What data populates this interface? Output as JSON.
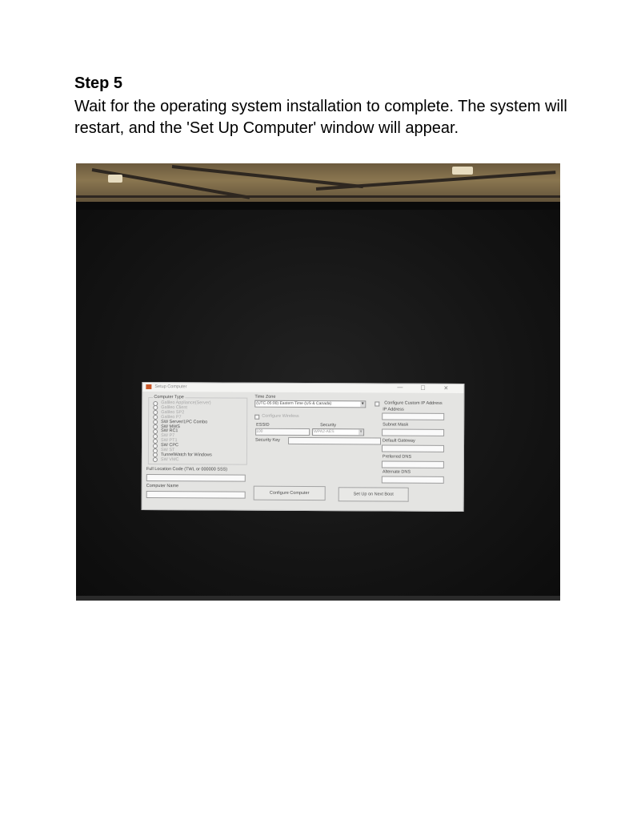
{
  "step": {
    "title": "Step 5",
    "text": "Wait for the operating system installation to complete. The system will restart, and the 'Set Up Computer' window will appear."
  },
  "dialog": {
    "title": "Setup Computer",
    "controls": {
      "minimize": "—",
      "maximize": "☐",
      "close": "✕"
    },
    "computer_type": {
      "legend": "Computer Type",
      "options": [
        {
          "label": "Galileo Appliance(Server)",
          "enabled": false
        },
        {
          "label": "Galileo Client",
          "enabled": false
        },
        {
          "label": "Galileo SP2",
          "enabled": false
        },
        {
          "label": "Galileo P7",
          "enabled": false
        },
        {
          "label": "SW Server/1PC Combo",
          "enabled": true
        },
        {
          "label": "SW MWS",
          "enabled": true
        },
        {
          "label": "SW RC1",
          "enabled": true
        },
        {
          "label": "SW P7",
          "enabled": false
        },
        {
          "label": "SW PT1",
          "enabled": false
        },
        {
          "label": "SW CPC",
          "enabled": true
        },
        {
          "label": "SW ST",
          "enabled": false
        },
        {
          "label": "TunnelWatch for Windows",
          "enabled": true
        },
        {
          "label": "SW VMC",
          "enabled": false
        }
      ]
    },
    "full_location_code_label": "Full Location Code (TWL or 000000 SSS)",
    "computer_name_label": "Computer Name",
    "time_zone": {
      "label": "Time Zone",
      "value": "(UTC-05:00) Eastern Time (US & Canada)"
    },
    "wireless": {
      "configure_label": "Configure Wireless",
      "essid_label": "ESSID",
      "essid_value": "100",
      "security_label": "Security",
      "security_value": "WPA2-AES",
      "security_key_label": "Security Key"
    },
    "ip": {
      "configure_label": "Configure Custom IP Address",
      "ip_address_label": "IP Address",
      "subnet_mask_label": "Subnet Mask",
      "default_gateway_label": "Default Gateway",
      "preferred_dns_label": "Preferred DNS",
      "alternate_dns_label": "Alternate DNS"
    },
    "buttons": {
      "configure": "Configure Computer",
      "setup_next_boot": "Set Up on Next Boot"
    }
  }
}
